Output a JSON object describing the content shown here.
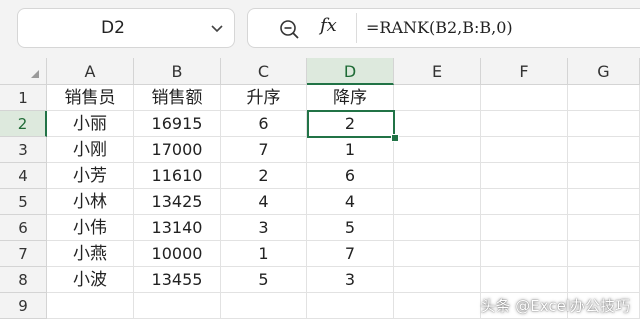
{
  "name_box": {
    "value": "D2"
  },
  "formula_bar": {
    "fx_label": "fx",
    "formula": "=RANK(B2,B:B,0)"
  },
  "columns": [
    "A",
    "B",
    "C",
    "D",
    "E",
    "F",
    "G"
  ],
  "rows": [
    "1",
    "2",
    "3",
    "4",
    "5",
    "6",
    "7",
    "8",
    "9"
  ],
  "selected_column": "D",
  "selected_row": "2",
  "table": {
    "headers": [
      "销售员",
      "销售额",
      "升序",
      "降序"
    ],
    "rows": [
      [
        "小丽",
        "16915",
        "6",
        "2"
      ],
      [
        "小刚",
        "17000",
        "7",
        "1"
      ],
      [
        "小芳",
        "11610",
        "2",
        "6"
      ],
      [
        "小林",
        "13425",
        "4",
        "4"
      ],
      [
        "小伟",
        "13140",
        "3",
        "5"
      ],
      [
        "小燕",
        "10000",
        "1",
        "7"
      ],
      [
        "小波",
        "13455",
        "5",
        "3"
      ]
    ]
  },
  "watermark": "头条 @Excel办公技巧",
  "colors": {
    "selection": "#217346",
    "header_bg": "#f3f3f3"
  }
}
